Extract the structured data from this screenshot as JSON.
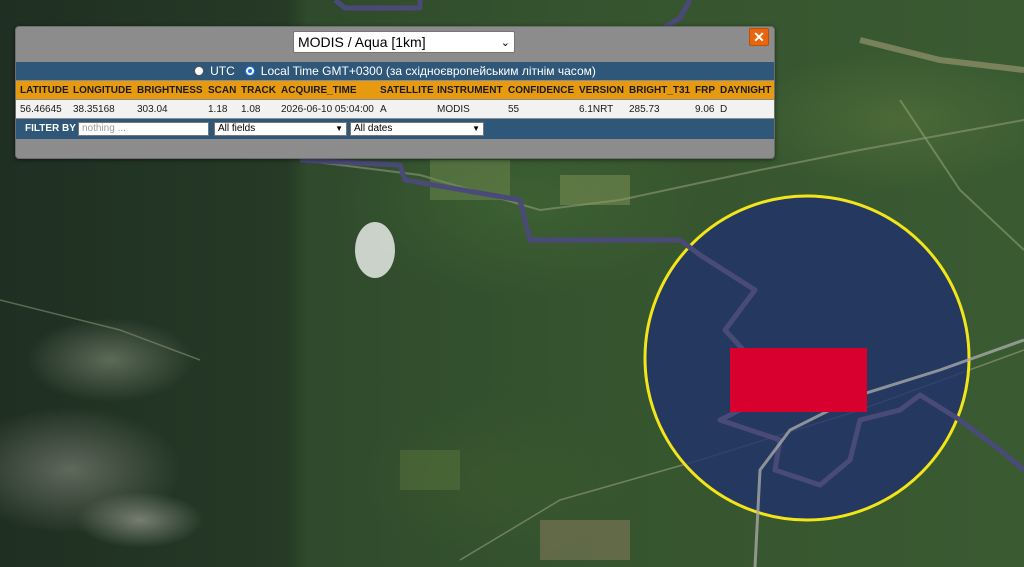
{
  "popup": {
    "sensor_selected": "MODIS / Aqua [1km]",
    "close_label": "✕",
    "time": {
      "utc_label": "UTC",
      "local_label": "Local Time GMT+0300 (за східноєвропейським літнім часом)",
      "selected": "local"
    },
    "columns": [
      "LATITUDE",
      "LONGITUDE",
      "BRIGHTNESS",
      "SCAN",
      "TRACK",
      "ACQUIRE_TIME",
      "SATELLITE",
      "INSTRUMENT",
      "CONFIDENCE",
      "VERSION",
      "BRIGHT_T31",
      "FRP",
      "DAYNIGHT"
    ],
    "row": [
      "56.46645",
      "38.35168",
      "303.04",
      "1.18",
      "1.08",
      "2026-06-10 05:04:00",
      "A",
      "MODIS",
      "55",
      "6.1NRT",
      "285.73",
      "9.06",
      "D"
    ],
    "filter": {
      "label": "FILTER BY",
      "placeholder": "nothing ...",
      "field_selected": "All fields",
      "date_selected": "All dates"
    }
  },
  "map": {
    "highlight_circle_color": "#f2e51a",
    "hotspot_color": "#d8002f",
    "boundary_color": "#4a4a78",
    "overlay_color": "#1f2f6e"
  }
}
